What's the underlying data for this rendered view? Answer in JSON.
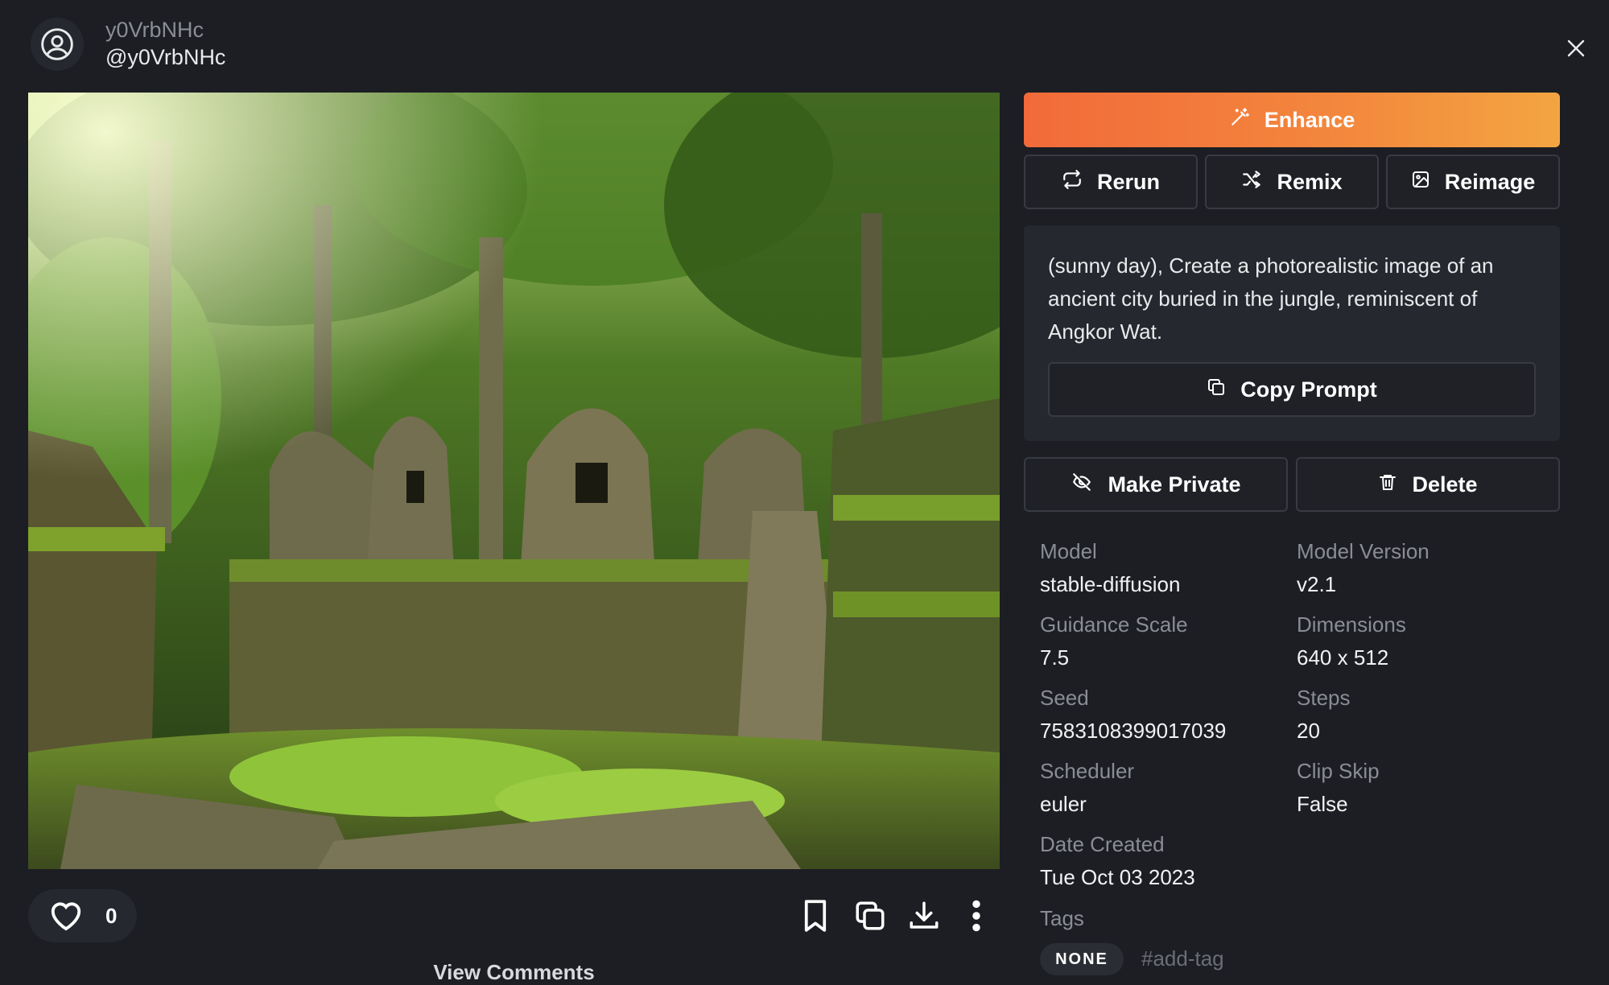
{
  "user": {
    "name": "y0VrbNHc",
    "handle": "@y0VrbNHc"
  },
  "image": {
    "alt": "ancient jungle temple ruins"
  },
  "likes": {
    "count": "0"
  },
  "comments": {
    "label": "View Comments"
  },
  "actions": {
    "enhance": "Enhance",
    "rerun": "Rerun",
    "remix": "Remix",
    "reimage": "Reimage",
    "copy_prompt": "Copy Prompt",
    "make_private": "Make Private",
    "delete": "Delete"
  },
  "prompt": {
    "text": "(sunny day), Create a photorealistic image of an ancient city buried in the jungle, reminiscent of Angkor Wat."
  },
  "meta": {
    "model_label": "Model",
    "model_value": "stable-diffusion",
    "version_label": "Model Version",
    "version_value": "v2.1",
    "guidance_label": "Guidance Scale",
    "guidance_value": "7.5",
    "dimensions_label": "Dimensions",
    "dimensions_value": "640 x 512",
    "seed_label": "Seed",
    "seed_value": "7583108399017039",
    "steps_label": "Steps",
    "steps_value": "20",
    "scheduler_label": "Scheduler",
    "scheduler_value": "euler",
    "clipskip_label": "Clip Skip",
    "clipskip_value": "False",
    "date_label": "Date Created",
    "date_value": "Tue Oct 03 2023",
    "tags_label": "Tags"
  },
  "tags": {
    "none": "NONE",
    "add": "#add-tag"
  },
  "colors": {
    "background": "#1c1e23",
    "accent_start": "#f26a3a",
    "accent_end": "#f3a542"
  },
  "icons": [
    "user-circle-icon",
    "close-icon",
    "heart-icon",
    "bookmark-icon",
    "copy-icon",
    "download-icon",
    "more-vertical-icon",
    "magic-wand-icon",
    "repeat-icon",
    "shuffle-icon",
    "image-icon",
    "copy-small-icon",
    "eye-off-icon",
    "trash-icon"
  ]
}
